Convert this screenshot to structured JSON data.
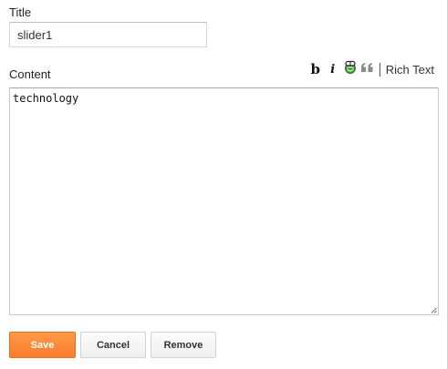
{
  "form": {
    "title_label": "Title",
    "title_value": "slider1",
    "content_label": "Content",
    "content_value": "technology"
  },
  "toolbar": {
    "bold_label": "b",
    "italic_label": "i",
    "link_icon": "link-icon",
    "quote_icon": "quote-icon",
    "rich_text_label": "Rich Text"
  },
  "buttons": {
    "save_label": "Save",
    "cancel_label": "Cancel",
    "remove_label": "Remove"
  },
  "colors": {
    "save_button": "#f98a35",
    "save_border": "#e06f22",
    "link_icon_green": "#3f8f2a"
  }
}
